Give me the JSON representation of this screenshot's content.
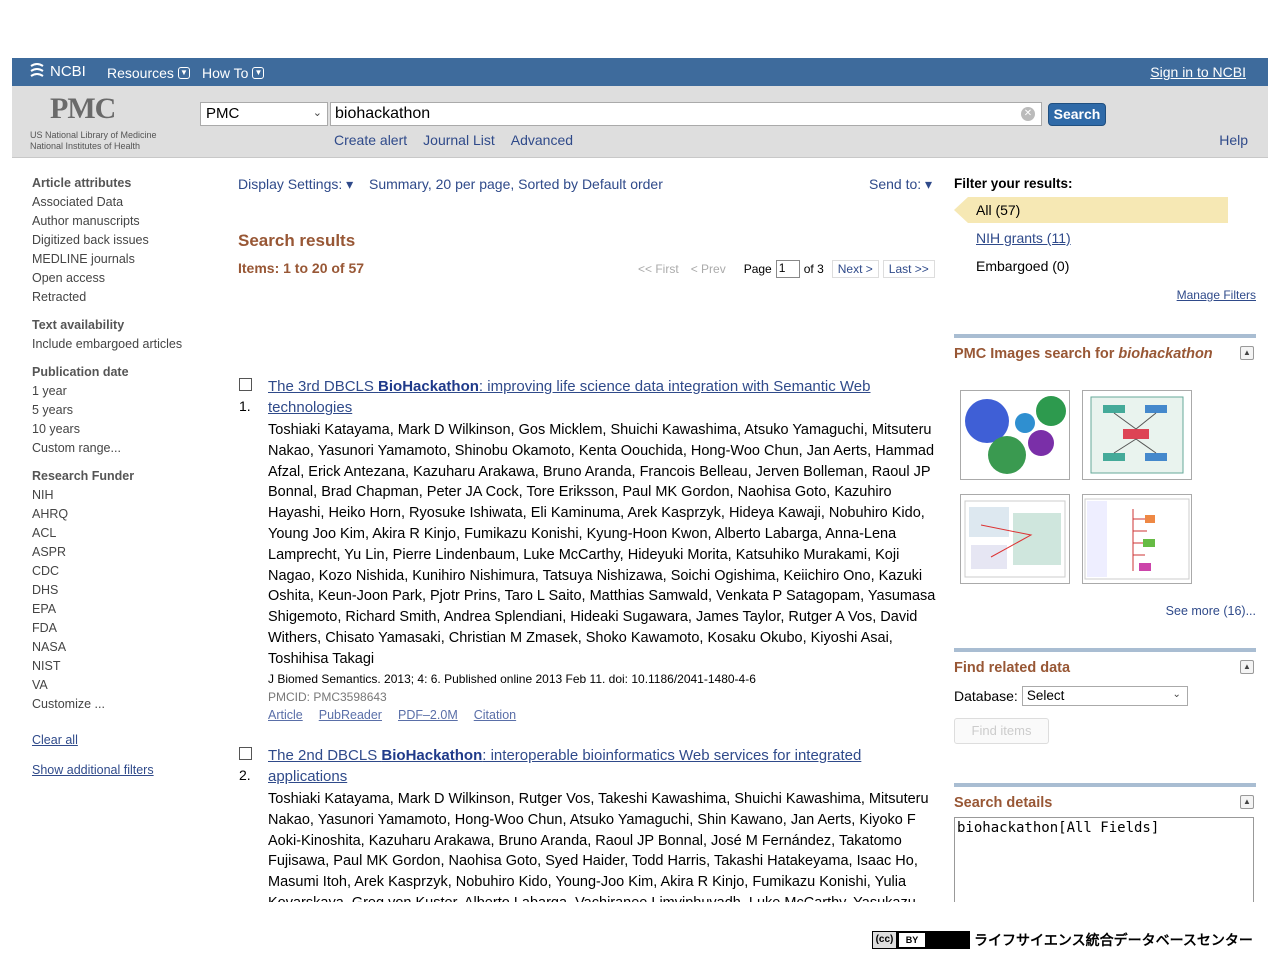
{
  "topbar": {
    "ncbi": "NCBI",
    "resources": "Resources",
    "howto": "How To",
    "signin": "Sign in to NCBI"
  },
  "header": {
    "logo_text": "PMC",
    "logo_line1": "US National Library of Medicine",
    "logo_line2": "National Institutes of Health",
    "db_value": "PMC",
    "search_value": "biohackathon",
    "search_button": "Search",
    "create_alert": "Create alert",
    "journal_list": "Journal List",
    "advanced": "Advanced",
    "help": "Help"
  },
  "sidebar": {
    "article_attributes": {
      "heading": "Article attributes",
      "items": [
        "Associated Data",
        "Author manuscripts",
        "Digitized back issues",
        "MEDLINE journals",
        "Open access",
        "Retracted"
      ]
    },
    "text_availability": {
      "heading": "Text availability",
      "items": [
        "Include embargoed articles"
      ]
    },
    "publication_date": {
      "heading": "Publication date",
      "items": [
        "1 year",
        "5 years",
        "10 years",
        "Custom range..."
      ]
    },
    "research_funder": {
      "heading": "Research Funder",
      "items": [
        "NIH",
        "AHRQ",
        "ACL",
        "ASPR",
        "CDC",
        "DHS",
        "EPA",
        "FDA",
        "NASA",
        "NIST",
        "VA",
        "Customize ..."
      ]
    },
    "clear_all": "Clear all",
    "show_filters": "Show additional filters"
  },
  "results": {
    "display_settings": "Display Settings:",
    "display_value": "Summary, 20 per page, Sorted by Default order",
    "send_to": "Send to:",
    "heading": "Search results",
    "items_text": "Items: 1 to 20 of 57",
    "pager": {
      "first": "<< First",
      "prev": "< Prev",
      "page_label": "Page",
      "page_value": "1",
      "of": "of 3",
      "next": "Next >",
      "last": "Last >>"
    },
    "list": [
      {
        "num": "1.",
        "title_pre": "The 3rd DBCLS ",
        "title_bold": "BioHackathon",
        "title_post": ": improving life science data integration with Semantic Web technologies",
        "authors": "Toshiaki Katayama, Mark D Wilkinson, Gos Micklem, Shuichi Kawashima, Atsuko Yamaguchi, Mitsuteru Nakao, Yasunori Yamamoto, Shinobu Okamoto, Kenta Oouchida, Hong-Woo Chun, Jan Aerts, Hammad Afzal, Erick Antezana, Kazuharu Arakawa, Bruno Aranda, Francois Belleau, Jerven Bolleman, Raoul JP Bonnal, Brad Chapman, Peter JA Cock, Tore Eriksson, Paul MK Gordon, Naohisa Goto, Kazuhiro Hayashi, Heiko Horn, Ryosuke Ishiwata, Eli Kaminuma, Arek Kasprzyk, Hideya Kawaji, Nobuhiro Kido, Young Joo Kim, Akira R Kinjo, Fumikazu Konishi, Kyung-Hoon Kwon, Alberto Labarga, Anna-Lena Lamprecht, Yu Lin, Pierre Lindenbaum, Luke McCarthy, Hideyuki Morita, Katsuhiko Murakami, Koji Nagao, Kozo Nishida, Kunihiro Nishimura, Tatsuya Nishizawa, Soichi Ogishima, Keiichiro Ono, Kazuki Oshita, Keun-Joon Park, Pjotr Prins, Taro L Saito, Matthias Samwald, Venkata P Satagopam, Yasumasa Shigemoto, Richard Smith, Andrea Splendiani, Hideaki Sugawara, James Taylor, Rutger A Vos, David Withers, Chisato Yamasaki, Christian M Zmasek, Shoko Kawamoto, Kosaku Okubo, Kiyoshi Asai, Toshihisa Takagi",
        "citation": "J Biomed Semantics. 2013; 4: 6. Published online 2013 Feb 11. doi: 10.1186/2041-1480-4-6",
        "pmcid": "PMCID: PMC3598643",
        "links": [
          "Article",
          "PubReader",
          "PDF–2.0M",
          "Citation"
        ]
      },
      {
        "num": "2.",
        "title_pre": "The 2nd DBCLS ",
        "title_bold": "BioHackathon",
        "title_post": ": interoperable bioinformatics Web services for integrated applications",
        "authors": "Toshiaki Katayama, Mark D Wilkinson, Rutger Vos, Takeshi Kawashima, Shuichi Kawashima, Mitsuteru Nakao, Yasunori Yamamoto, Hong-Woo Chun, Atsuko Yamaguchi, Shin Kawano, Jan Aerts, Kiyoko F Aoki-Kinoshita, Kazuharu Arakawa, Bruno Aranda, Raoul JP Bonnal, José M Fernández, Takatomo Fujisawa, Paul MK Gordon, Naohisa Goto, Syed Haider, Todd Harris, Takashi Hatakeyama, Isaac Ho, Masumi Itoh, Arek Kasprzyk, Nobuhiro Kido, Young-Joo Kim, Akira R Kinjo, Fumikazu Konishi, Yulia Kovarskaya, Greg von Kuster, Alberto Labarga, Vachiranee Limviphuvadh, Luke McCarthy, Yasukazu Nakamura, Yunsun Nam, Kozo Nishida, Kunihiro Nishimura, Tatsuya Nishizawa, Soichi Ogishima, Tom Oinn, Shinobu Okamoto, Shujiro Okuda, Keiichiro Ono, Kazuki"
      }
    ]
  },
  "right": {
    "filter_heading": "Filter your results:",
    "filters": [
      "All (57)",
      "NIH grants (11)",
      "Embargoed (0)"
    ],
    "manage": "Manage Filters",
    "images_heading_pre": "PMC Images search for ",
    "images_heading_term": "biohackathon",
    "see_more": "See more (16)...",
    "related_heading": "Find related data",
    "database_label": "Database:",
    "database_value": "Select",
    "find_items": "Find items",
    "details_heading": "Search details",
    "details_value": "biohackathon[All Fields]"
  },
  "footer": {
    "cc": "(cc)",
    "by": "BY",
    "org": "ライフサイエンス統合データベースセンター"
  }
}
